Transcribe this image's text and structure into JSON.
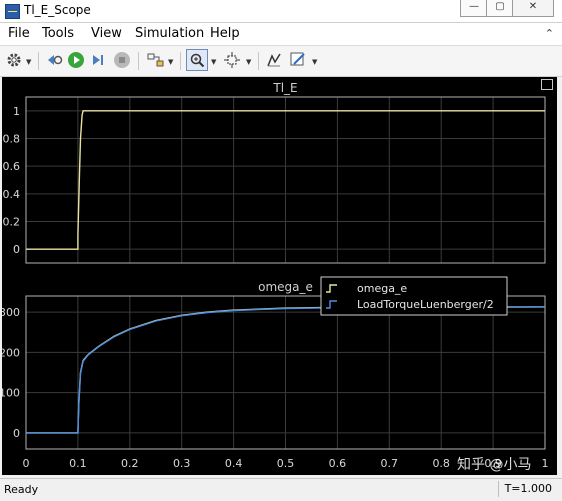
{
  "window": {
    "title": "Tl_E_Scope",
    "controls": {
      "minimize": "—",
      "maximize": "▢",
      "close": "✕"
    }
  },
  "menu": [
    "File",
    "Tools",
    "View",
    "Simulation",
    "Help"
  ],
  "toolbar": {
    "icons": [
      "settings-gear-icon",
      "step-back-icon",
      "run-icon",
      "step-forward-icon",
      "stop-icon",
      "highlight-block-icon",
      "zoom-icon",
      "fit-to-view-icon",
      "cursor-measure-icon",
      "edit-style-icon"
    ]
  },
  "status": {
    "ready": "Ready",
    "time": "T=1.000"
  },
  "watermark": "知乎 @小马",
  "colors": {
    "signal1": "#e8e4a0",
    "signal2": "#4d8fe0",
    "plot_bg": "#000000",
    "frame": "#b4b4b4",
    "grid": "#3b3b3b",
    "tick_text": "#d8d8d8"
  },
  "chart_data": [
    {
      "type": "line",
      "title": "Tl_E",
      "xlim": [
        0,
        1
      ],
      "ylim": [
        -0.1,
        1.1
      ],
      "yticks": [
        0,
        0.2,
        0.4,
        0.6,
        0.8,
        1
      ],
      "grid": true,
      "series": [
        {
          "name": "",
          "color": "#e8e4a0",
          "x": [
            0,
            0.1,
            0.1,
            0.103,
            0.105,
            0.108,
            0.11,
            0.2,
            0.4,
            0.6,
            0.8,
            1.0
          ],
          "y": [
            0,
            0,
            0.1,
            0.55,
            0.8,
            0.97,
            1.0,
            1.0,
            1.0,
            1.0,
            1.0,
            1.0
          ]
        }
      ]
    },
    {
      "type": "line",
      "title": "omega_e",
      "xlim": [
        0,
        1
      ],
      "ylim": [
        -40,
        340
      ],
      "xticks": [
        0,
        0.1,
        0.2,
        0.3,
        0.4,
        0.5,
        0.6,
        0.7,
        0.8,
        0.9,
        1
      ],
      "yticks": [
        0,
        100,
        200,
        300
      ],
      "grid": true,
      "legend_position": "top-right",
      "series": [
        {
          "name": "omega_e",
          "color": "#e8e4a0",
          "x": [
            0,
            0.1,
            0.102,
            0.105,
            0.11,
            0.12,
            0.14,
            0.17,
            0.2,
            0.25,
            0.3,
            0.35,
            0.4,
            0.5,
            0.6,
            0.7,
            0.8,
            0.9,
            1.0
          ],
          "y": [
            0,
            0,
            80,
            150,
            180,
            195,
            215,
            240,
            258,
            279,
            292,
            300,
            305,
            310,
            312,
            313,
            313,
            313,
            313
          ]
        },
        {
          "name": "LoadTorqueLuenberger/2",
          "color": "#4d8fe0",
          "x": [
            0,
            0.1,
            0.102,
            0.105,
            0.11,
            0.12,
            0.14,
            0.17,
            0.2,
            0.25,
            0.3,
            0.35,
            0.4,
            0.5,
            0.6,
            0.7,
            0.8,
            0.9,
            1.0
          ],
          "y": [
            0,
            0,
            75,
            148,
            178,
            194,
            214,
            239,
            257,
            278,
            291,
            299,
            304,
            309,
            311,
            312,
            313,
            312,
            313
          ]
        }
      ]
    }
  ]
}
